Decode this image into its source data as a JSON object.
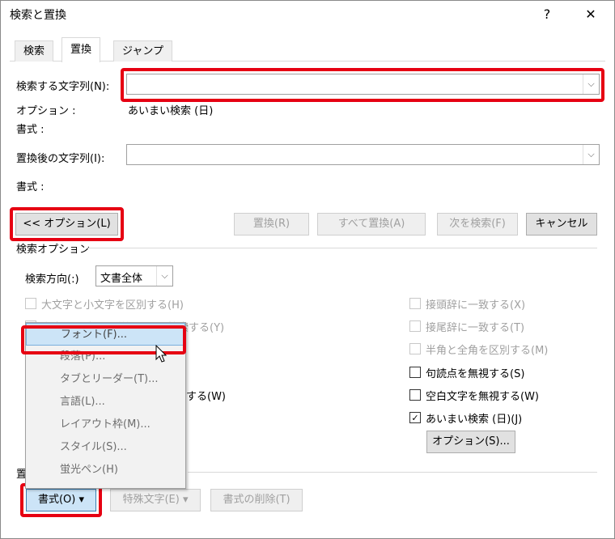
{
  "window": {
    "title": "検索と置換",
    "help_glyph": "?",
    "close_glyph": "✕"
  },
  "tabs": [
    {
      "label": "検索"
    },
    {
      "label": "置換"
    },
    {
      "label": "ジャンプ"
    }
  ],
  "find": {
    "label": "検索する文字列(N):",
    "value": ""
  },
  "options_row": {
    "label": "オプション :",
    "value": "あいまい検索 (日)"
  },
  "format1": {
    "label": "書式 :"
  },
  "replace": {
    "label": "置換後の文字列(I):",
    "value": ""
  },
  "format2": {
    "label": "書式 :"
  },
  "buttons": {
    "options_toggle": "<< オプション(L)",
    "replace": "置換(R)",
    "replace_all": "すべて置換(A)",
    "find_next": "次を検索(F)",
    "cancel": "キャンセル"
  },
  "search_options": {
    "heading": "検索オプション",
    "direction_label": "検索方向(:)",
    "direction_value": "文書全体",
    "left_checks": [
      {
        "label": "大文字と小文字を区別する(H)",
        "checked": false,
        "enabled": false
      },
      {
        "label": "完全に一致する単語だけを検索する(Y)",
        "checked": false,
        "enabled": false
      },
      {
        "label": "する(W)",
        "checked": false,
        "enabled": true
      }
    ],
    "right_checks": [
      {
        "label": "接頭辞に一致する(X)",
        "checked": false,
        "enabled": false
      },
      {
        "label": "接尾辞に一致する(T)",
        "checked": false,
        "enabled": false
      },
      {
        "label": "半角と全角を区別する(M)",
        "checked": false,
        "enabled": false
      },
      {
        "label": "句読点を無視する(S)",
        "checked": false,
        "enabled": true
      },
      {
        "label": "空白文字を無視する(W)",
        "checked": false,
        "enabled": true
      },
      {
        "label": "あいまい検索 (日)(J)",
        "checked": true,
        "enabled": true
      }
    ],
    "options_button": "オプション(S)..."
  },
  "bottom": {
    "section_label": "置",
    "format_button": "書式(O) ▾",
    "special_button": "特殊文字(E) ▾",
    "clear_format_button": "書式の削除(T)"
  },
  "format_menu": [
    "フォント(F)...",
    "段落(P)...",
    "タブとリーダー(T)...",
    "言語(L)...",
    "レイアウト枠(M)...",
    "スタイル(S)...",
    "蛍光ペン(H)"
  ],
  "colors": {
    "highlight_red": "#e60012",
    "menu_highlight": "#cce4f7",
    "disabled_text": "#a0a0a0"
  }
}
